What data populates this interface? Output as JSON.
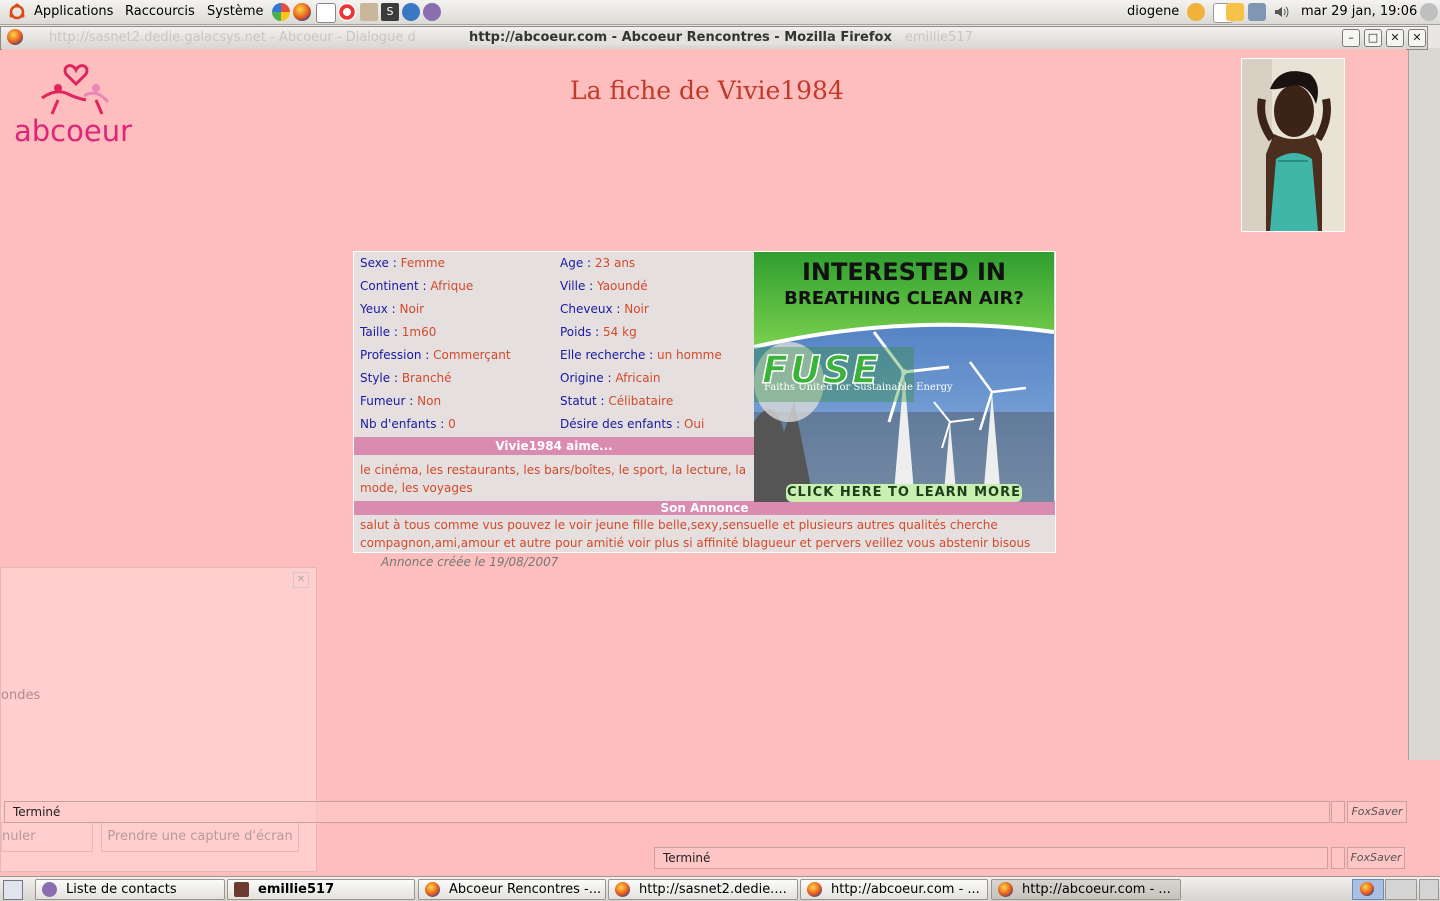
{
  "top_panel": {
    "menu_applications": "Applications",
    "menu_shortcuts": "Raccourcis",
    "menu_system": "Système",
    "username": "diogene",
    "clock": "mar 29 jan, 19:06"
  },
  "background_window": {
    "title": "http://sasnet2.dedie.galacsys.net - Abcoeur - Dialogue d",
    "title_right": "emillie517"
  },
  "window": {
    "title": "http://abcoeur.com - Abcoeur Rencontres - Mozilla Firefox",
    "min": "–",
    "max": "□",
    "close": "✕"
  },
  "page": {
    "logo_text": "abcoeur",
    "title": "La fiche de Vivie1984",
    "fields": [
      {
        "label": "Sexe",
        "value": "Femme"
      },
      {
        "label": "Age",
        "value": "23 ans"
      },
      {
        "label": "Continent",
        "value": "Afrique"
      },
      {
        "label": "Ville",
        "value": "Yaoundé"
      },
      {
        "label": "Yeux",
        "value": "Noir"
      },
      {
        "label": "Cheveux",
        "value": "Noir"
      },
      {
        "label": "Taille",
        "value": "1m60"
      },
      {
        "label": "Poids",
        "value": "54 kg"
      },
      {
        "label": "Profession",
        "value": "Commerçant"
      },
      {
        "label": "Elle recherche",
        "value": "un homme"
      },
      {
        "label": "Style",
        "value": "Branché"
      },
      {
        "label": "Origine",
        "value": "Africain"
      },
      {
        "label": "Fumeur",
        "value": "Non"
      },
      {
        "label": "Statut",
        "value": "Célibataire"
      },
      {
        "label": "Nb d'enfants",
        "value": "0"
      },
      {
        "label": "Désire des enfants",
        "value": "Oui"
      }
    ],
    "likes_header": "Vivie1984 aime...",
    "likes_text": "le cinéma, les restaurants, les bars/boîtes, le sport, la lecture, la mode, les voyages",
    "annonce_header": "Son Annonce",
    "annonce_text": "salut à tous comme vus pouvez le voir jeune fille belle,sexy,sensuelle et plusieurs autres qualités cherche compagnon,ami,amour et autre pour amitié voir plus si affinité blagueur et pervers veillez vous abstenir bisous",
    "created": "Annonce créée le 19/08/2007"
  },
  "ad": {
    "headline_1": "INTERESTED IN",
    "headline_2": "BREATHING CLEAN AIR?",
    "brand": "FUSE",
    "tagline": "Faiths United for Sustainable Energy",
    "cta": "CLICK HERE TO LEARN MORE"
  },
  "dialog": {
    "close": "✕",
    "partial_text": "ondes",
    "cancel_partial": "nuler",
    "capture_button": "Prendre une capture d'écran"
  },
  "status": {
    "main_text": "Terminé",
    "foxsaver": "FoxSaver",
    "second_text": "Terminé",
    "second_foxsaver": "FoxSaver"
  },
  "taskbar": {
    "items": [
      {
        "label": "Liste de contacts"
      },
      {
        "label": "emillie517"
      },
      {
        "label": "Abcoeur Rencontres -..."
      },
      {
        "label": "http://sasnet2.dedie...."
      },
      {
        "label": "http://abcoeur.com - ..."
      },
      {
        "label": "http://abcoeur.com - ..."
      }
    ]
  },
  "colors": {
    "page_bg": "#ffbebe",
    "label_blue": "#1a1aa0",
    "value_red": "#d24a2a",
    "band_pink": "#d98bb0",
    "title_red": "#c0392b"
  }
}
